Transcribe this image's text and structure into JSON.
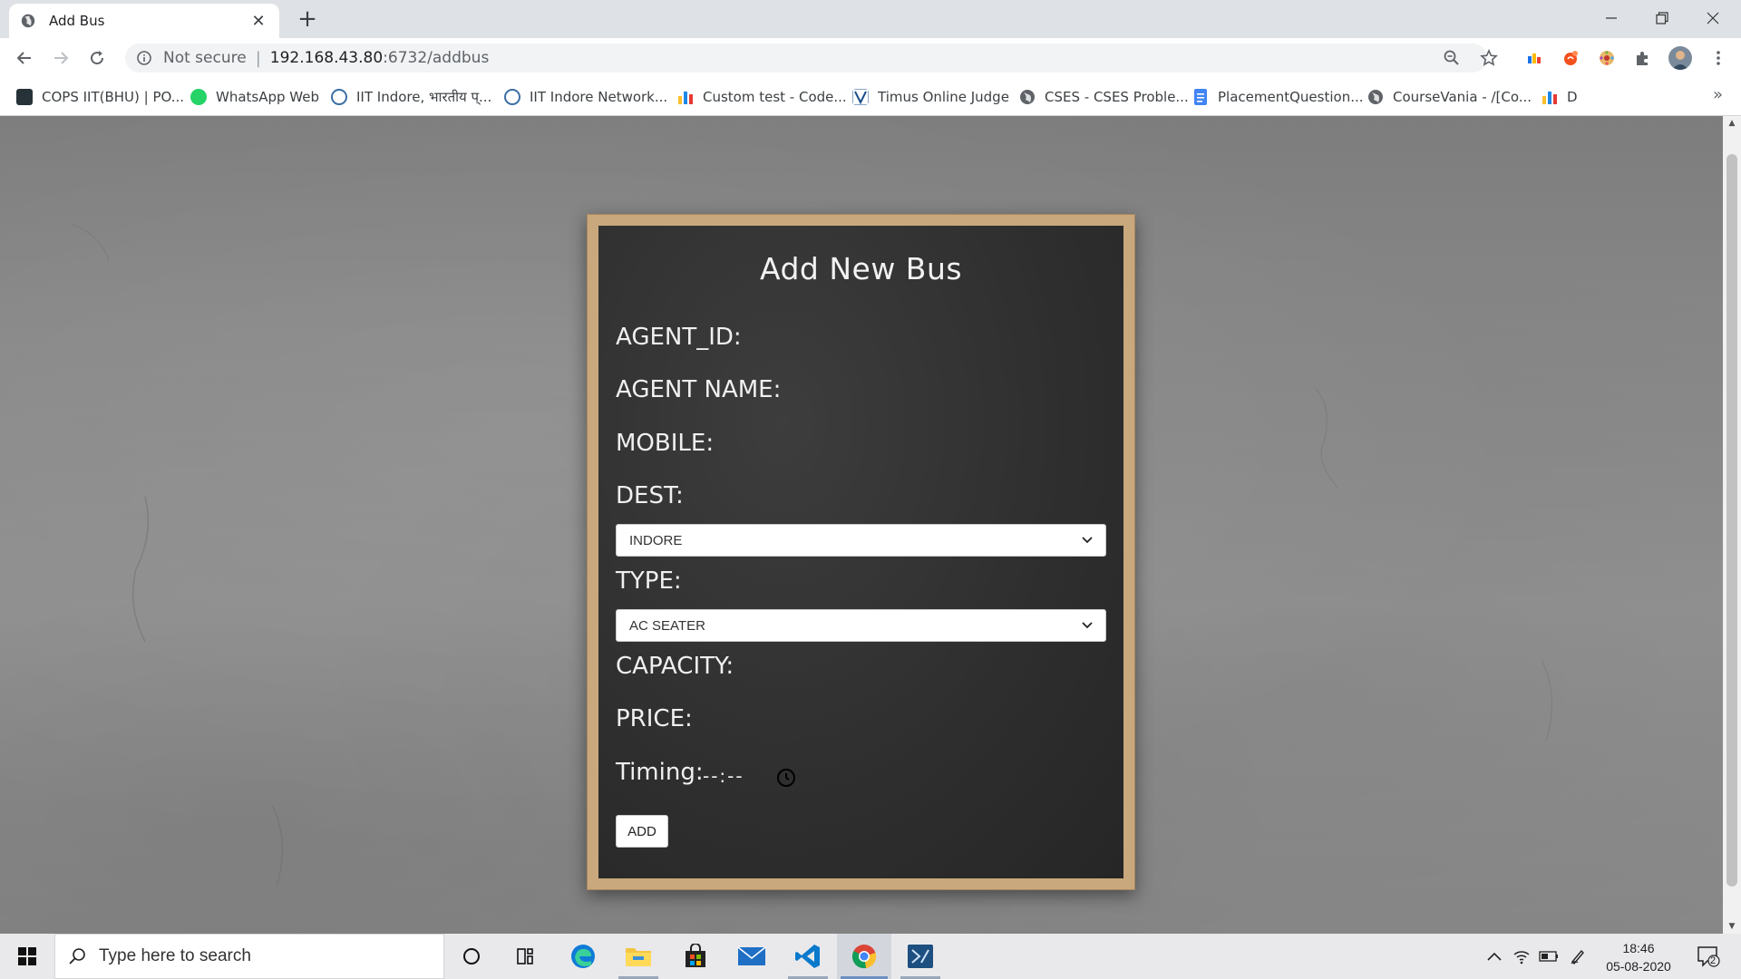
{
  "browser": {
    "tab_title": "Add Bus",
    "tab_close": "✕",
    "new_tab": "+",
    "url_security": "Not secure",
    "url_host": "192.168.43.80",
    "url_path": ":6732/addbus",
    "bookmarks": [
      {
        "label": "COPS IIT(BHU) | PO...",
        "icon_color": "#263238"
      },
      {
        "label": "WhatsApp Web",
        "icon_color": "#25d366"
      },
      {
        "label": "IIT Indore, भारतीय प्...",
        "icon_color": "#3a6ea5"
      },
      {
        "label": "IIT Indore Network...",
        "icon_color": "#3a6ea5"
      },
      {
        "label": "Custom test - Code...",
        "icon_color": "#1f8acb"
      },
      {
        "label": "Timus Online Judge",
        "icon_color": "#1a4d8c"
      },
      {
        "label": "CSES - CSES Proble...",
        "icon_color": "#5f6368"
      },
      {
        "label": "PlacementQuestion...",
        "icon_color": "#4285f4"
      },
      {
        "label": "CourseVania - /[Co...",
        "icon_color": "#5f6368"
      },
      {
        "label": "D",
        "icon_color": "#1f8acb"
      }
    ],
    "bookmarks_more": "»"
  },
  "form": {
    "title": "Add New Bus",
    "agent_id_label": "AGENT_ID:",
    "agent_name_label": "AGENT NAME:",
    "mobile_label": "MOBILE:",
    "dest_label": "DEST:",
    "dest_value": "INDORE",
    "type_label": "TYPE:",
    "type_value": "AC SEATER",
    "capacity_label": "CAPACITY:",
    "price_label": "PRICE:",
    "timing_label": "Timing:",
    "timing_value": "--:--",
    "add_button": "ADD"
  },
  "taskbar": {
    "search_placeholder": "Type here to search",
    "time": "18:46",
    "date": "05-08-2020",
    "notification_count": "2"
  },
  "colors": {
    "board_frame": "#c8a87c",
    "board_background": "#2e2e2e",
    "wall": "#8c8c8c"
  }
}
